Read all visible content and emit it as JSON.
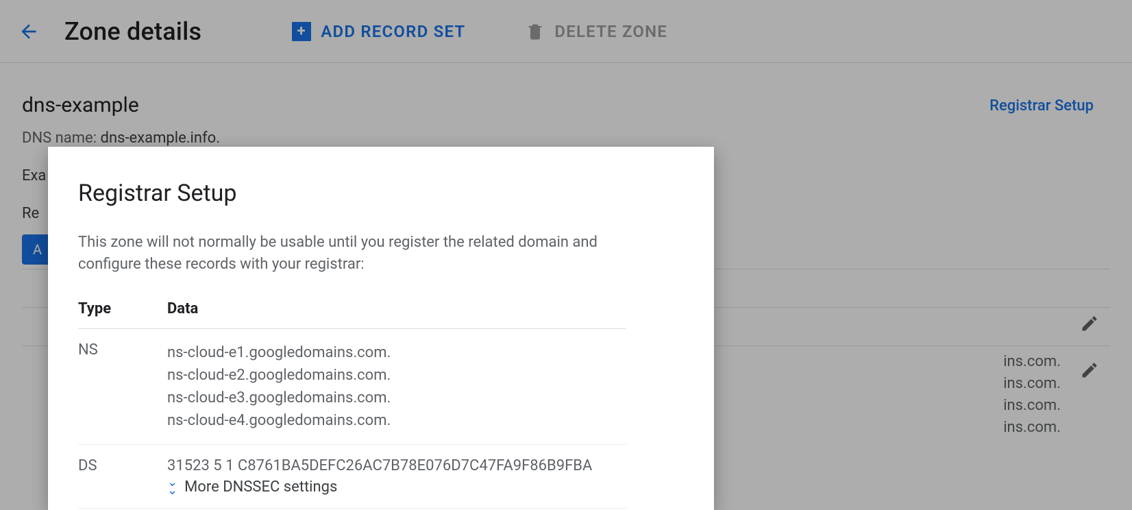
{
  "toolbar": {
    "page_title": "Zone details",
    "add_record_set": "ADD RECORD SET",
    "delete_zone": "DELETE ZONE"
  },
  "page": {
    "zone_name": "dns-example",
    "dns_name_label": "DNS name:",
    "dns_name_value": "dns-example.info.",
    "registrar_link": "Registrar Setup",
    "exa_prefix": "Exa",
    "rec_prefix": "Re",
    "blue_btn_prefix": "A",
    "bg_row_text": [
      "ins.com.",
      "ins.com.",
      "ins.com.",
      "ins.com."
    ]
  },
  "dialog": {
    "title": "Registrar Setup",
    "description": "This zone will not normally be usable until you register the related domain and configure these records with your registrar:",
    "col_type": "Type",
    "col_data": "Data",
    "rows": {
      "ns": {
        "type": "NS",
        "values": [
          "ns-cloud-e1.googledomains.com.",
          "ns-cloud-e2.googledomains.com.",
          "ns-cloud-e3.googledomains.com.",
          "ns-cloud-e4.googledomains.com."
        ]
      },
      "ds": {
        "type": "DS",
        "value": "31523 5 1 C8761BA5DEFC26AC7B78E076D7C47FA9F86B9FBA",
        "more": "More DNSSEC settings"
      }
    }
  }
}
